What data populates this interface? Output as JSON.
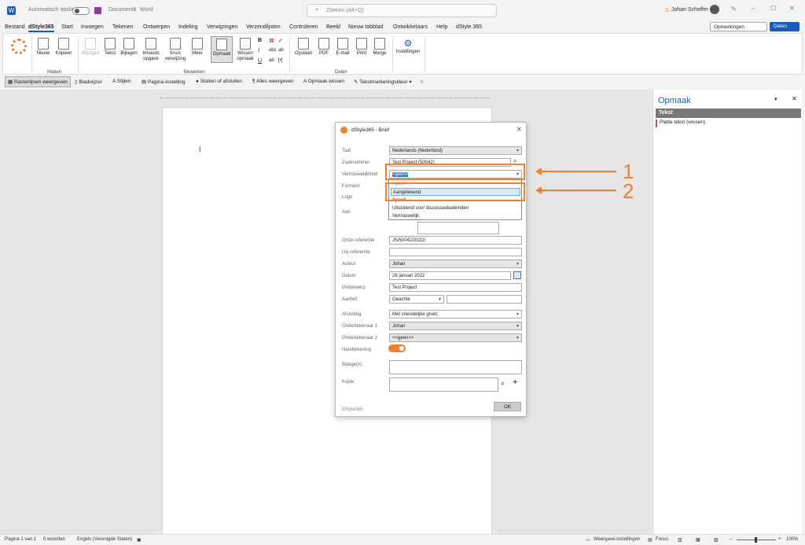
{
  "titlebar": {
    "autosave": "Automatisch opslaan",
    "doc": "Document1",
    "app": "Word",
    "search": "Zoeken (Alt+Q)",
    "user": "Johan Scheffer"
  },
  "menu": [
    "Bestand",
    "dStyle365",
    "Start",
    "Invoegen",
    "Tekenen",
    "Ontwerpen",
    "Indeling",
    "Verwijzingen",
    "Verzendlijsten",
    "Controleren",
    "Beeld",
    "Nieuw tabblad",
    "Ontwikkelaars",
    "Help",
    "dStyle 365"
  ],
  "comments_btn": "Opmerkingen",
  "share_btn": "Delen",
  "ribbon": {
    "maken": [
      "Nieuw",
      "Kopieer"
    ],
    "bewerken": [
      "Wijzigen",
      "Tekst",
      "Bijlagen",
      "Inhouds opgave",
      "Kruis verwijzing",
      "Meer",
      "Opmaak",
      "Wissen opmaak"
    ],
    "fmt": [
      "B",
      "I",
      "U",
      "ab",
      "abc",
      "[•]"
    ],
    "delen": [
      "Opslaan",
      "PDF",
      "E-mail",
      "Print",
      "Merge"
    ],
    "inst": "Instellingen",
    "groups": [
      "Maken",
      "Bewerken",
      "Delen"
    ]
  },
  "toolbar2": [
    "Rasterlijnen weergeven",
    "Bladwijzer",
    "Stijlen",
    "Pagina-instelling",
    "Sluiten of afsluiten",
    "Alles weergeven",
    "Opmaak wissen",
    "Tekstmarkeringskleur"
  ],
  "pane": {
    "title": "Opmaak",
    "section": "Tekst",
    "item": "Platte tekst (wissen)"
  },
  "dialog": {
    "title": "dStyle365 - Brief",
    "labels": [
      "Taal",
      "Zaaknummer",
      "Vertrouwelijkheid",
      "Formeel",
      "Logo",
      "Aan",
      "Onze referentie",
      "Uw referentie",
      "Auteur",
      "Datum",
      "Onderwerp",
      "Aanhef",
      "Afsluiting",
      "Ondertekenaar 1",
      "Ondertekenaar 2",
      "Handtekening",
      "Bijlage(n)",
      "Kopie"
    ],
    "taal": "Nederlands (Nederland)",
    "zaak": "Test Project (50042)",
    "vertrouw": "<geen>",
    "options": [
      "<geen>",
      "Aangetekend",
      "Spoed",
      "Uitsluitend voor discussiedoeleinden",
      "Vertrouwelijk"
    ],
    "onze_ref": "JS/50042/2022/",
    "auteur": "Johan",
    "datum": "26 januari 2022",
    "onderwerp": "Test Project",
    "aanhef": "Geachte",
    "afsluiting": "Met vriendelijke groet,",
    "ond1": "Johan",
    "ond2": "<<geen>>",
    "footer": "dStyle365",
    "ok": "OK"
  },
  "annot": [
    "1",
    "2"
  ],
  "status": {
    "page": "Pagina 1 van 1",
    "words": "0 woorden",
    "lang": "Engels (Verenigde Staten)",
    "view": "Weergave-instellingen",
    "focus": "Focus",
    "zoom": "100%"
  }
}
